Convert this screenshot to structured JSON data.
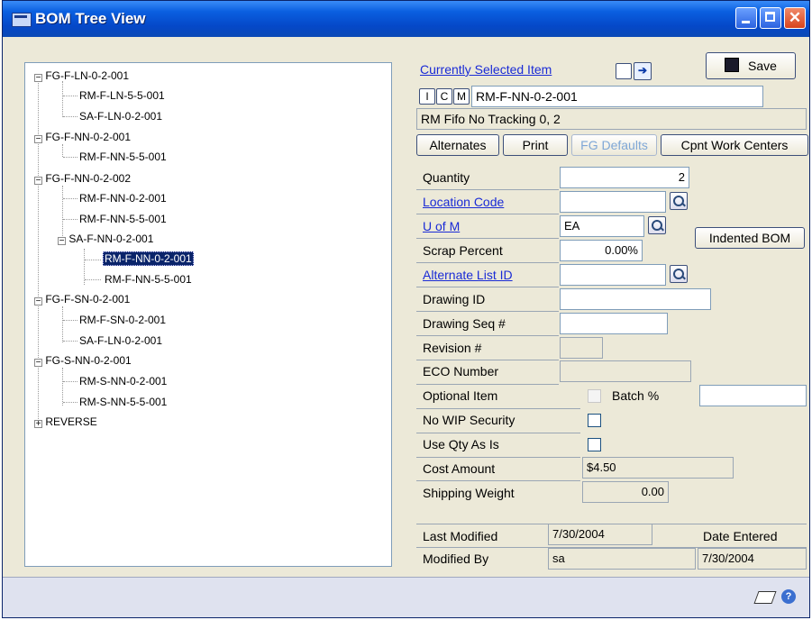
{
  "window": {
    "title": "BOM Tree View"
  },
  "tree": {
    "nodes": [
      {
        "label": "FG-F-LN-0-2-001"
      },
      {
        "label": "RM-F-LN-5-5-001"
      },
      {
        "label": "SA-F-LN-0-2-001"
      },
      {
        "label": "FG-F-NN-0-2-001"
      },
      {
        "label": "RM-F-NN-5-5-001"
      },
      {
        "label": "FG-F-NN-0-2-002"
      },
      {
        "label": "RM-F-NN-0-2-001"
      },
      {
        "label": "RM-F-NN-5-5-001"
      },
      {
        "label": "SA-F-NN-0-2-001"
      },
      {
        "label": "RM-F-NN-0-2-001"
      },
      {
        "label": "RM-F-NN-5-5-001"
      },
      {
        "label": "FG-F-SN-0-2-001"
      },
      {
        "label": "RM-F-SN-0-2-001"
      },
      {
        "label": "SA-F-LN-0-2-001"
      },
      {
        "label": "FG-S-NN-0-2-001"
      },
      {
        "label": "RM-S-NN-0-2-001"
      },
      {
        "label": "RM-S-NN-5-5-001"
      },
      {
        "label": "REVERSE"
      }
    ],
    "expand_minus": "−",
    "expand_plus": "+"
  },
  "panel": {
    "current_item_label": "Currently Selected Item",
    "save_label": "Save",
    "item_type_buttons": [
      "I",
      "C",
      "M"
    ],
    "item_code": "RM-F-NN-0-2-001",
    "item_desc": "RM Fifo No Tracking 0, 2",
    "tabs": {
      "alternates": "Alternates",
      "print": "Print",
      "fg_defaults": "FG Defaults",
      "cpnt_work_centers": "Cpnt Work Centers"
    },
    "indented_bom_label": "Indented BOM",
    "fields": {
      "quantity": {
        "label": "Quantity",
        "value": "2"
      },
      "location_code": {
        "label": "Location Code",
        "value": ""
      },
      "u_of_m": {
        "label": "U of M",
        "value": "EA"
      },
      "scrap_percent": {
        "label": "Scrap Percent",
        "value": "0.00%"
      },
      "alternate_list_id": {
        "label": "Alternate List ID",
        "value": ""
      },
      "drawing_id": {
        "label": "Drawing ID",
        "value": ""
      },
      "drawing_seq": {
        "label": "Drawing Seq #",
        "value": ""
      },
      "revision": {
        "label": "Revision #",
        "value": ""
      },
      "eco_number": {
        "label": "ECO Number",
        "value": ""
      },
      "optional_item": {
        "label": "Optional Item"
      },
      "batch_pct": {
        "label": "Batch %",
        "value": ""
      },
      "no_wip_security": {
        "label": "No WIP Security"
      },
      "use_qty_as_is": {
        "label": "Use Qty As Is"
      },
      "cost_amount": {
        "label": "Cost Amount",
        "value": "$4.50"
      },
      "shipping_weight": {
        "label": "Shipping Weight",
        "value": "0.00"
      }
    },
    "last_modified": {
      "label": "Last Modified",
      "value": "7/30/2004"
    },
    "modified_by": {
      "label": "Modified By",
      "value": "sa"
    },
    "date_entered": {
      "label": "Date  Entered",
      "value": "7/30/2004"
    }
  }
}
